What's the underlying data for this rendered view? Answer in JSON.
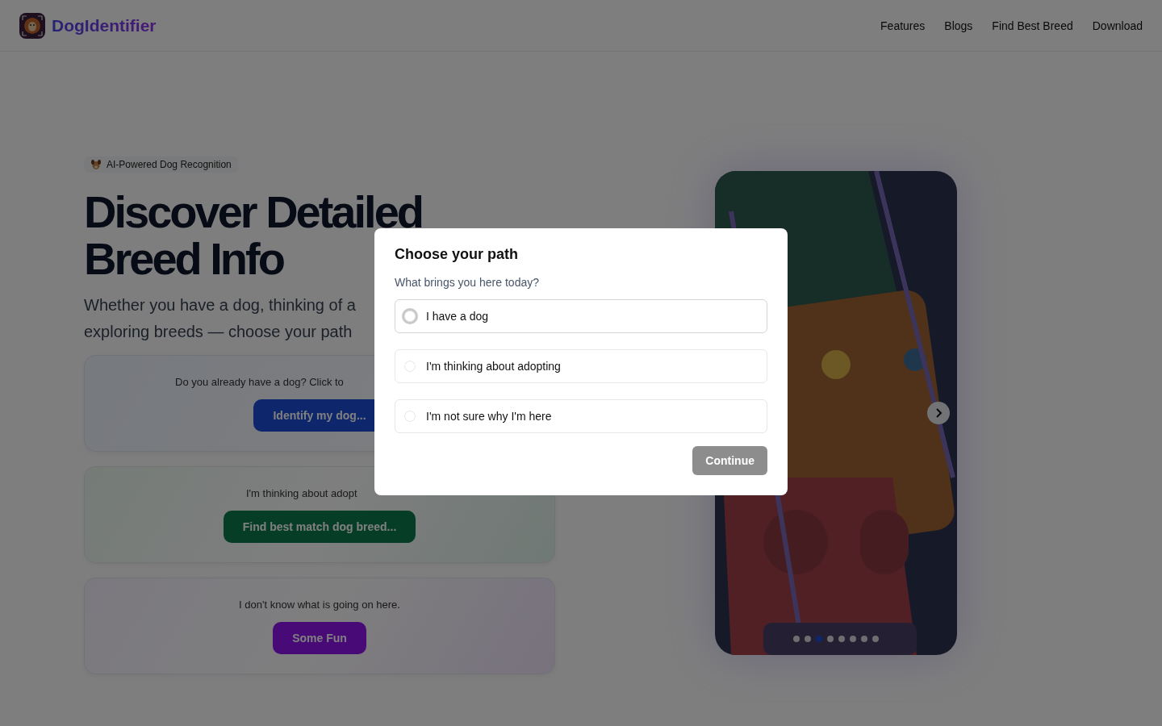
{
  "nav": {
    "brand": "DogIdentifier",
    "links": [
      "Features",
      "Blogs",
      "Find Best Breed",
      "Download"
    ]
  },
  "hero": {
    "badge": "AI-Powered Dog Recognition",
    "title_lines": [
      "Discover Detailed",
      "Breed Info"
    ],
    "subtitle_lines": [
      "Whether you have a dog, thinking of a",
      "exploring breeds — choose your path"
    ],
    "cards": [
      {
        "kind": "blue",
        "text": "Do you already have a dog? Click to",
        "button": "Identify my dog..."
      },
      {
        "kind": "green",
        "text": "I'm thinking about adopt",
        "button": "Find best match dog breed..."
      },
      {
        "kind": "purple",
        "text": "I don't know what is going on here.",
        "button": "Some Fun"
      }
    ]
  },
  "carousel": {
    "kind": "picture",
    "dots": [
      {
        "selected": false
      },
      {
        "selected": false
      },
      {
        "selected": true
      },
      {
        "selected": false
      },
      {
        "selected": false
      },
      {
        "selected": false
      },
      {
        "selected": false
      },
      {
        "selected": false
      }
    ]
  },
  "modal": {
    "title": "Choose your path",
    "question": "What brings you here today?",
    "options": [
      {
        "label": "I have a dog",
        "selected": false,
        "focused": true
      },
      {
        "label": "I'm thinking about adopting",
        "selected": false,
        "focused": false
      },
      {
        "label": "I'm not sure why I'm here",
        "selected": false,
        "focused": false
      }
    ],
    "button": {
      "label": "Continue",
      "disabled": true
    }
  }
}
